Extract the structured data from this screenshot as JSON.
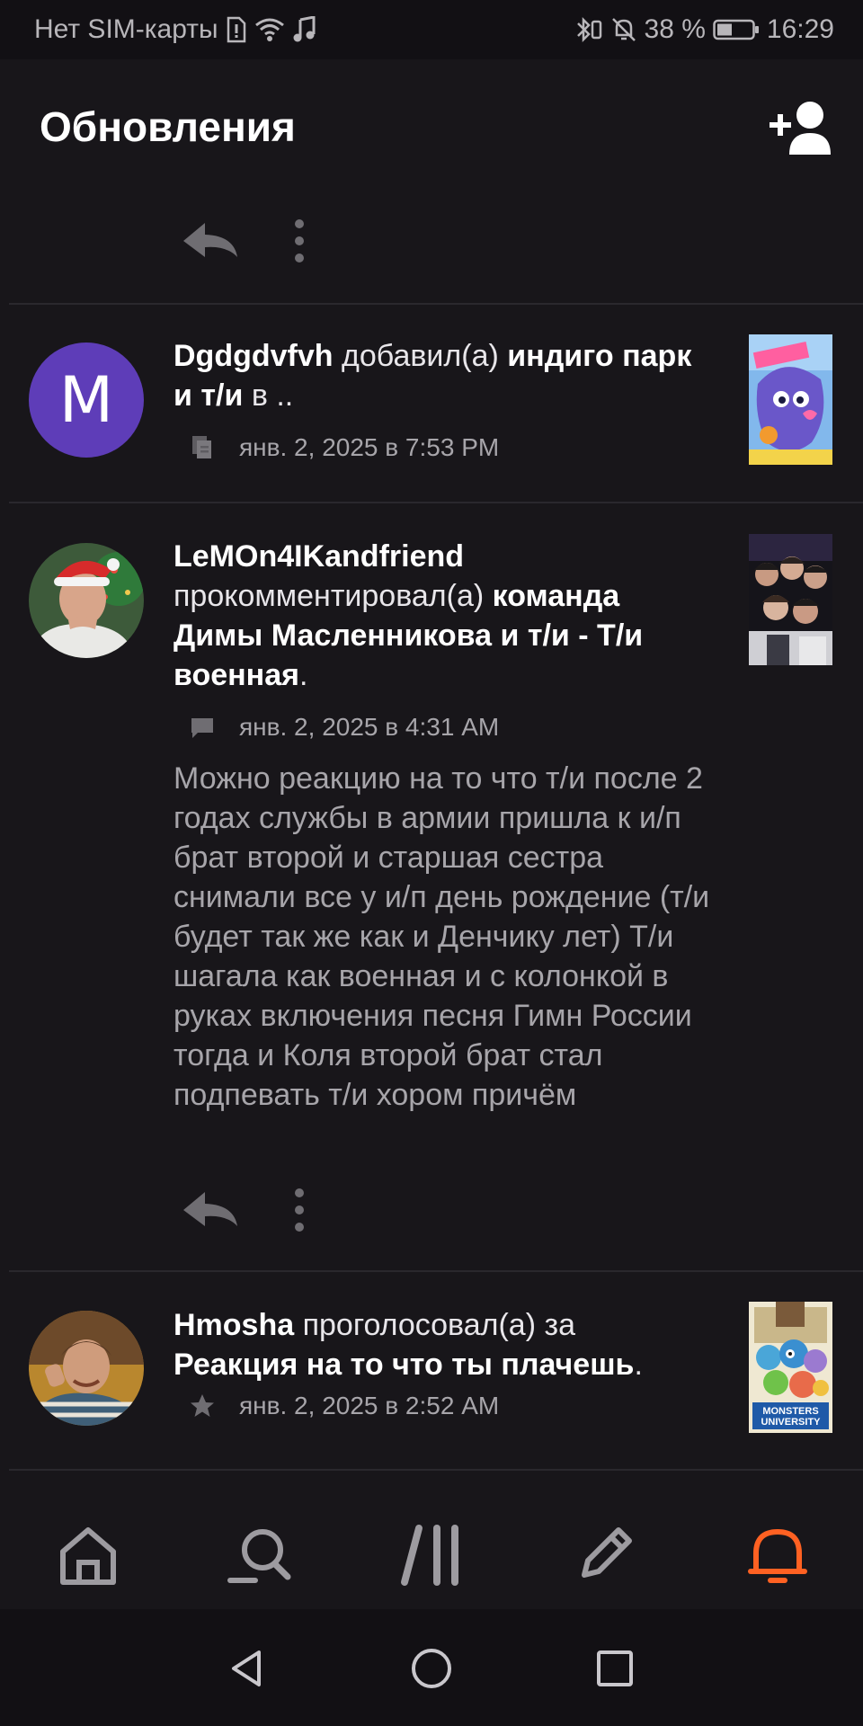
{
  "status_bar": {
    "carrier": "Нет SIM-карты",
    "battery": "38 %",
    "time": "16:29"
  },
  "header": {
    "title": "Обновления",
    "add_user_icon": "add-user-icon"
  },
  "feed": {
    "items": [
      {
        "avatar_letter": "M",
        "avatar_color": "#5e3db8",
        "user": "Dgdgdvfvh",
        "action": "добавил(а)",
        "target": "индиго парк и т/и",
        "suffix": "в ..",
        "meta_icon": "reading-list-icon",
        "date": "янв. 2, 2025 в 7:53 PM"
      },
      {
        "user": "LeMOn4IKandfriend",
        "action": "прокомментировал(а)",
        "target": "команда Димы Масленникова и т/и - Т/и военная",
        "suffix": ".",
        "meta_icon": "comment-icon",
        "date": "янв. 2, 2025 в 4:31 AM",
        "comment": "Можно реакцию на то что т/и после 2 годах службы в армии пришла к и/п брат второй и старшая сестра снимали все у и/п день рождение (т/и будет так же как и Денчику лет) Т/и шагала как военная и с колонкой в руках включения песня Гимн России тогда и Коля второй брат стал подпевать т/и хором причём"
      },
      {
        "user": "Hmosha",
        "action": "проголосовал(а) за",
        "target": "Реакция на то что ты плачешь",
        "suffix": ".",
        "meta_icon": "star-icon",
        "date": "янв. 2, 2025 в 2:52 AM",
        "thumb_caption": "MONSTERS UNIVERSITY"
      }
    ]
  },
  "bottom_nav": {
    "items": [
      "home-icon",
      "search-icon",
      "library-icon",
      "write-icon",
      "notifications-icon"
    ],
    "active": "notifications-icon",
    "accent": "#ff6122"
  }
}
